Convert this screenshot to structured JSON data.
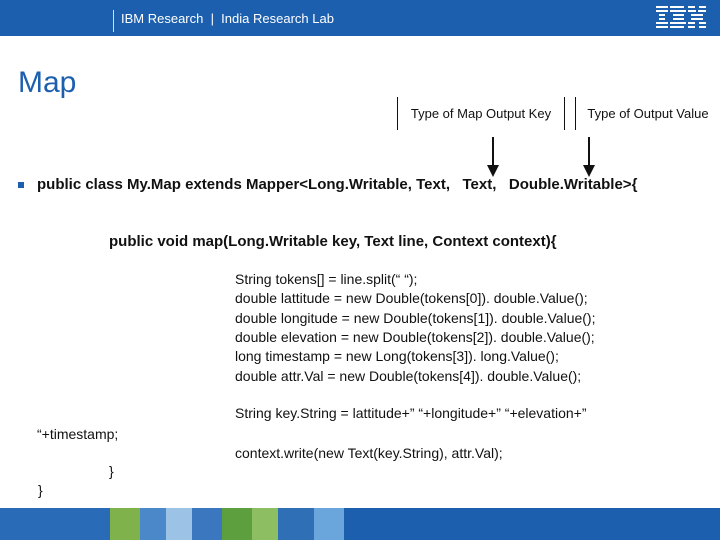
{
  "header": {
    "org_text": "IBM Research  |  India Research Lab",
    "logo_text": "IBM"
  },
  "slide": {
    "title": "Map",
    "annotations": {
      "key_label": "Type of Map Output Key",
      "value_label": "Type of Output Value"
    },
    "code": {
      "class_decl": "public class My.Map extends Mapper<Long.Writable, Text,   Text,   Double.Writable>{",
      "method_decl": "public void map(Long.Writable key, Text line, Context context){",
      "body_lines": [
        "String tokens[] = line.split(“ “);",
        "double lattitude = new Double(tokens[0]). double.Value();",
        "double longitude = new Double(tokens[1]). double.Value();",
        "double elevation = new Double(tokens[2]). double.Value();",
        "long timestamp = new Long(tokens[3]). long.Value();",
        "double attr.Val = new Double(tokens[4]). double.Value();"
      ],
      "key_string_line": "String key.String = lattitude+” “+longitude+” “+elevation+”",
      "key_string_cont": "“+timestamp;",
      "write_line": "context.write(new Text(key.String), attr.Val);",
      "close_method": "}",
      "close_class": "}"
    }
  },
  "colors": {
    "brand_blue": "#1c5fae",
    "title_blue": "#1c5fae"
  }
}
